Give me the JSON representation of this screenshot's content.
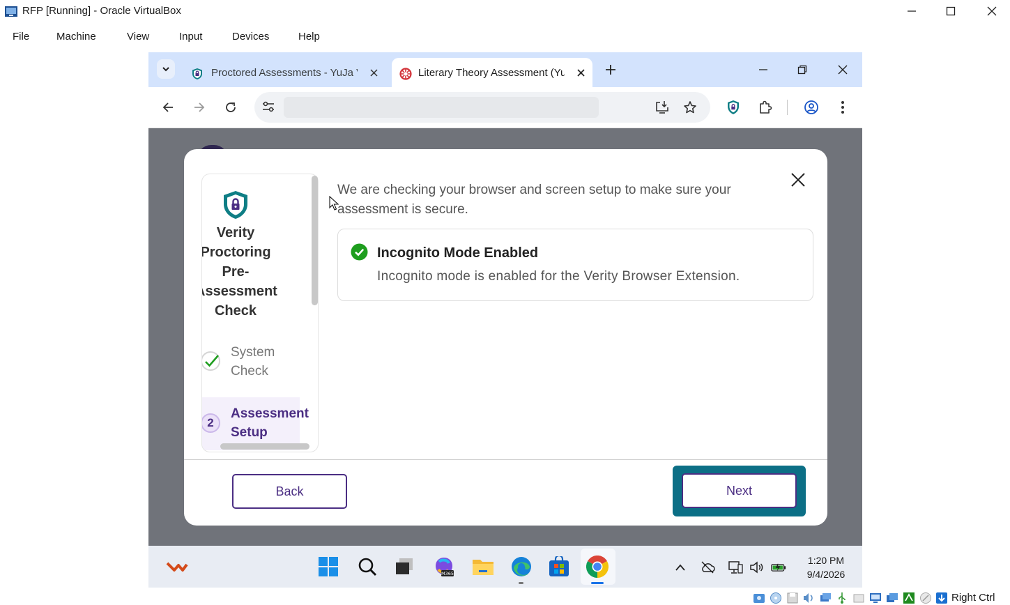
{
  "window": {
    "title": "RFP [Running] - Oracle VirtualBox",
    "icon": "virtualbox-icon"
  },
  "menubar": [
    "File",
    "Machine",
    "View",
    "Input",
    "Devices",
    "Help"
  ],
  "browser": {
    "tabs": [
      {
        "label": "Proctored Assessments - YuJa Verity",
        "icon": "verity-shield-icon",
        "active": false
      },
      {
        "label": "Literary Theory Assessment (YuJa)",
        "icon": "yuja-icon",
        "active": true
      }
    ],
    "address_value": "",
    "icons": [
      "back-icon",
      "forward-icon",
      "reload-icon",
      "site-info-icon",
      "install-app-icon",
      "bookmark-star-icon",
      "verity-extension-icon",
      "extensions-icon",
      "profile-icon",
      "menu-icon"
    ]
  },
  "modal": {
    "sidebar": {
      "title": "Verity Proctoring Pre-Assessment Check",
      "steps": [
        {
          "label": "System Check",
          "status": "complete"
        },
        {
          "number": "2",
          "label": "Assessment Setup",
          "status": "current"
        }
      ]
    },
    "intro": "We are checking your browser and screen setup to make sure your assessment is secure.",
    "result": {
      "title": "Incognito Mode Enabled",
      "description": "Incognito mode is enabled for the Verity Browser Extension.",
      "status_color": "#1e9e1e"
    },
    "back_label": "Back",
    "next_label": "Next"
  },
  "taskbar": {
    "time": "1:20 PM",
    "date": "9/4/2026",
    "apps": [
      "widgets-icon",
      "start-icon",
      "search-icon",
      "task-view-icon",
      "m365-icon",
      "file-explorer-icon",
      "edge-icon",
      "store-icon",
      "chrome-icon"
    ]
  },
  "statusbar": {
    "host_key": "Right Ctrl"
  },
  "colors": {
    "accent": "#4b2e83",
    "focus_ring": "#0c6f86",
    "overlay": "#70737a",
    "tabstrip": "#d3e3fd"
  }
}
